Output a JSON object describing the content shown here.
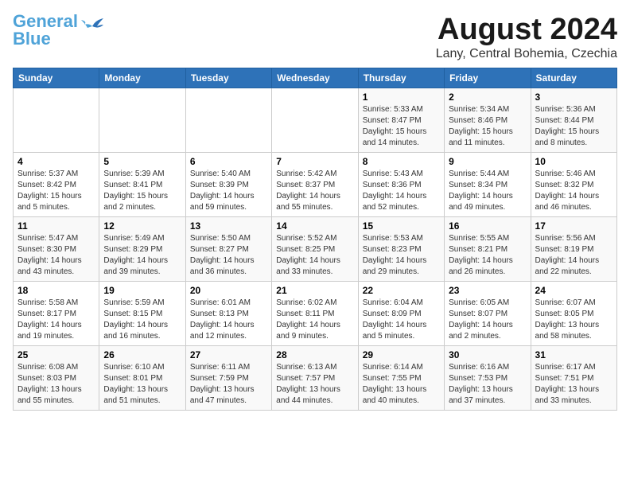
{
  "header": {
    "logo_line1": "General",
    "logo_line2": "Blue",
    "main_title": "August 2024",
    "subtitle": "Lany, Central Bohemia, Czechia"
  },
  "days_of_week": [
    "Sunday",
    "Monday",
    "Tuesday",
    "Wednesday",
    "Thursday",
    "Friday",
    "Saturday"
  ],
  "weeks": [
    [
      {
        "day": "",
        "info": ""
      },
      {
        "day": "",
        "info": ""
      },
      {
        "day": "",
        "info": ""
      },
      {
        "day": "",
        "info": ""
      },
      {
        "day": "1",
        "info": "Sunrise: 5:33 AM\nSunset: 8:47 PM\nDaylight: 15 hours\nand 14 minutes."
      },
      {
        "day": "2",
        "info": "Sunrise: 5:34 AM\nSunset: 8:46 PM\nDaylight: 15 hours\nand 11 minutes."
      },
      {
        "day": "3",
        "info": "Sunrise: 5:36 AM\nSunset: 8:44 PM\nDaylight: 15 hours\nand 8 minutes."
      }
    ],
    [
      {
        "day": "4",
        "info": "Sunrise: 5:37 AM\nSunset: 8:42 PM\nDaylight: 15 hours\nand 5 minutes."
      },
      {
        "day": "5",
        "info": "Sunrise: 5:39 AM\nSunset: 8:41 PM\nDaylight: 15 hours\nand 2 minutes."
      },
      {
        "day": "6",
        "info": "Sunrise: 5:40 AM\nSunset: 8:39 PM\nDaylight: 14 hours\nand 59 minutes."
      },
      {
        "day": "7",
        "info": "Sunrise: 5:42 AM\nSunset: 8:37 PM\nDaylight: 14 hours\nand 55 minutes."
      },
      {
        "day": "8",
        "info": "Sunrise: 5:43 AM\nSunset: 8:36 PM\nDaylight: 14 hours\nand 52 minutes."
      },
      {
        "day": "9",
        "info": "Sunrise: 5:44 AM\nSunset: 8:34 PM\nDaylight: 14 hours\nand 49 minutes."
      },
      {
        "day": "10",
        "info": "Sunrise: 5:46 AM\nSunset: 8:32 PM\nDaylight: 14 hours\nand 46 minutes."
      }
    ],
    [
      {
        "day": "11",
        "info": "Sunrise: 5:47 AM\nSunset: 8:30 PM\nDaylight: 14 hours\nand 43 minutes."
      },
      {
        "day": "12",
        "info": "Sunrise: 5:49 AM\nSunset: 8:29 PM\nDaylight: 14 hours\nand 39 minutes."
      },
      {
        "day": "13",
        "info": "Sunrise: 5:50 AM\nSunset: 8:27 PM\nDaylight: 14 hours\nand 36 minutes."
      },
      {
        "day": "14",
        "info": "Sunrise: 5:52 AM\nSunset: 8:25 PM\nDaylight: 14 hours\nand 33 minutes."
      },
      {
        "day": "15",
        "info": "Sunrise: 5:53 AM\nSunset: 8:23 PM\nDaylight: 14 hours\nand 29 minutes."
      },
      {
        "day": "16",
        "info": "Sunrise: 5:55 AM\nSunset: 8:21 PM\nDaylight: 14 hours\nand 26 minutes."
      },
      {
        "day": "17",
        "info": "Sunrise: 5:56 AM\nSunset: 8:19 PM\nDaylight: 14 hours\nand 22 minutes."
      }
    ],
    [
      {
        "day": "18",
        "info": "Sunrise: 5:58 AM\nSunset: 8:17 PM\nDaylight: 14 hours\nand 19 minutes."
      },
      {
        "day": "19",
        "info": "Sunrise: 5:59 AM\nSunset: 8:15 PM\nDaylight: 14 hours\nand 16 minutes."
      },
      {
        "day": "20",
        "info": "Sunrise: 6:01 AM\nSunset: 8:13 PM\nDaylight: 14 hours\nand 12 minutes."
      },
      {
        "day": "21",
        "info": "Sunrise: 6:02 AM\nSunset: 8:11 PM\nDaylight: 14 hours\nand 9 minutes."
      },
      {
        "day": "22",
        "info": "Sunrise: 6:04 AM\nSunset: 8:09 PM\nDaylight: 14 hours\nand 5 minutes."
      },
      {
        "day": "23",
        "info": "Sunrise: 6:05 AM\nSunset: 8:07 PM\nDaylight: 14 hours\nand 2 minutes."
      },
      {
        "day": "24",
        "info": "Sunrise: 6:07 AM\nSunset: 8:05 PM\nDaylight: 13 hours\nand 58 minutes."
      }
    ],
    [
      {
        "day": "25",
        "info": "Sunrise: 6:08 AM\nSunset: 8:03 PM\nDaylight: 13 hours\nand 55 minutes."
      },
      {
        "day": "26",
        "info": "Sunrise: 6:10 AM\nSunset: 8:01 PM\nDaylight: 13 hours\nand 51 minutes."
      },
      {
        "day": "27",
        "info": "Sunrise: 6:11 AM\nSunset: 7:59 PM\nDaylight: 13 hours\nand 47 minutes."
      },
      {
        "day": "28",
        "info": "Sunrise: 6:13 AM\nSunset: 7:57 PM\nDaylight: 13 hours\nand 44 minutes."
      },
      {
        "day": "29",
        "info": "Sunrise: 6:14 AM\nSunset: 7:55 PM\nDaylight: 13 hours\nand 40 minutes."
      },
      {
        "day": "30",
        "info": "Sunrise: 6:16 AM\nSunset: 7:53 PM\nDaylight: 13 hours\nand 37 minutes."
      },
      {
        "day": "31",
        "info": "Sunrise: 6:17 AM\nSunset: 7:51 PM\nDaylight: 13 hours\nand 33 minutes."
      }
    ]
  ]
}
